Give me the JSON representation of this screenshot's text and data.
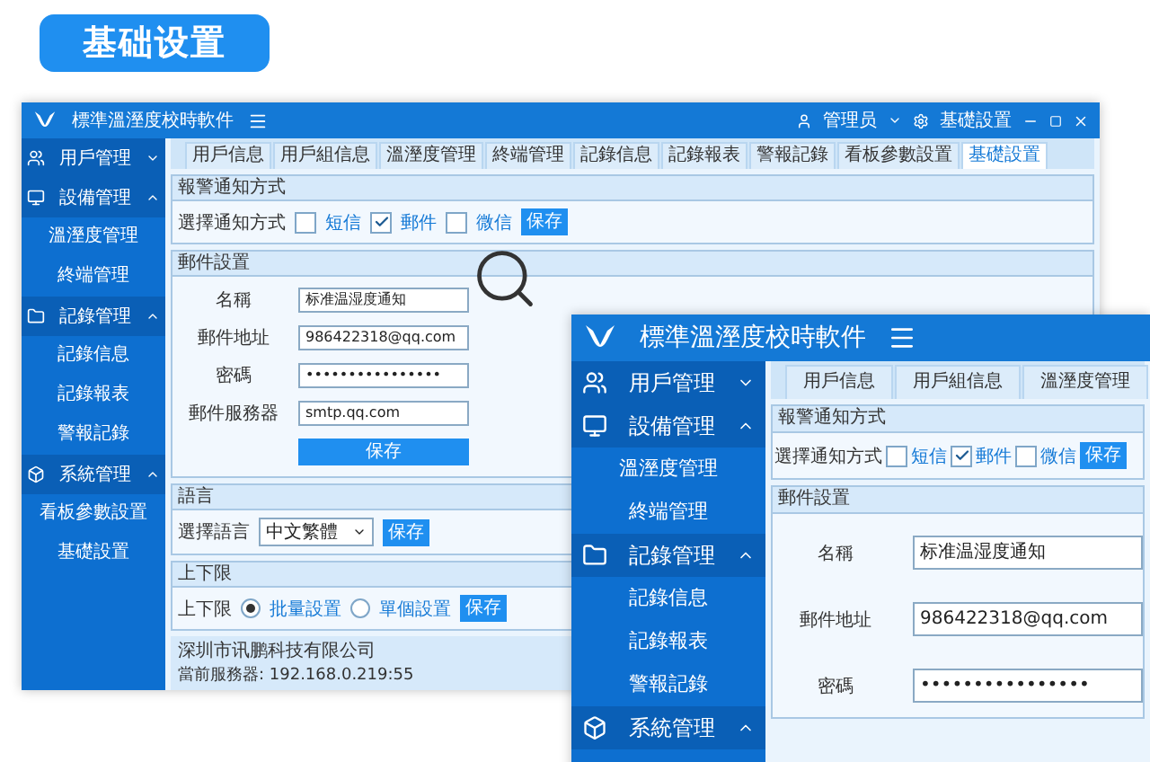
{
  "header": {
    "title": "基础设置"
  },
  "back_window": {
    "title": "標準溫溼度校時軟件",
    "user": "管理员",
    "settings_link": "基礎設置",
    "sidebar": [
      {
        "label": "用戶管理",
        "expanded": false
      },
      {
        "label": "設備管理",
        "expanded": true,
        "children": [
          {
            "label": "溫溼度管理"
          },
          {
            "label": "終端管理"
          }
        ]
      },
      {
        "label": "記錄管理",
        "expanded": true,
        "children": [
          {
            "label": "記錄信息"
          },
          {
            "label": "記錄報表"
          },
          {
            "label": "警報記錄"
          }
        ]
      },
      {
        "label": "系統管理",
        "expanded": true,
        "children": [
          {
            "label": "看板參數設置"
          },
          {
            "label": "基礎設置"
          }
        ]
      }
    ],
    "tabs": [
      {
        "label": "用戶信息",
        "selected": false
      },
      {
        "label": "用戶組信息",
        "selected": false
      },
      {
        "label": "溫溼度管理",
        "selected": false
      },
      {
        "label": "終端管理",
        "selected": false
      },
      {
        "label": "記錄信息",
        "selected": false
      },
      {
        "label": "記錄報表",
        "selected": false
      },
      {
        "label": "警報記錄",
        "selected": false
      },
      {
        "label": "看板參數設置",
        "selected": false
      },
      {
        "label": "基礎設置",
        "selected": true
      }
    ],
    "sections": [
      {
        "kind": "checkboxes",
        "title": "報警通知方式",
        "label": "選擇通知方式",
        "options": [
          {
            "label": "短信",
            "checked": false
          },
          {
            "label": "郵件",
            "checked": true
          },
          {
            "label": "微信",
            "checked": false
          }
        ],
        "button": "保存"
      },
      {
        "kind": "form",
        "title": "郵件設置",
        "fields": [
          {
            "label": "名稱",
            "value": "标准温湿度通知"
          },
          {
            "label": "郵件地址",
            "value": "986422318@qq.com"
          },
          {
            "label": "密碼",
            "value": "••••••••••••••••"
          },
          {
            "label": "郵件服務器",
            "value": "smtp.qq.com"
          }
        ],
        "button": "保存"
      },
      {
        "kind": "select",
        "title": "語言",
        "label": "選擇語言",
        "value": "中文繁體",
        "button": "保存"
      },
      {
        "kind": "radios",
        "title": "上下限",
        "label": "上下限",
        "options": [
          {
            "label": "批量設置",
            "selected": true
          },
          {
            "label": "單個設置",
            "selected": false
          }
        ],
        "button": "保存"
      }
    ],
    "status_bar": {
      "company": "深圳市讯鹏科技有限公司",
      "server": "當前服務器: 192.168.0.219:55"
    }
  },
  "front_window": {
    "title": "標準溫溼度校時軟件",
    "sidebar": [
      {
        "label": "用戶管理",
        "expanded": false
      },
      {
        "label": "設備管理",
        "expanded": true,
        "children": [
          {
            "label": "溫溼度管理"
          },
          {
            "label": "終端管理"
          }
        ]
      },
      {
        "label": "記錄管理",
        "expanded": true,
        "children": [
          {
            "label": "記錄信息"
          },
          {
            "label": "記錄報表"
          },
          {
            "label": "警報記錄"
          }
        ]
      },
      {
        "label": "系統管理",
        "expanded": true
      }
    ],
    "tabs": [
      {
        "label": "用戶信息",
        "selected": false
      },
      {
        "label": "用戶組信息",
        "selected": false
      },
      {
        "label": "溫溼度管理",
        "selected": false
      }
    ],
    "sections": [
      {
        "kind": "checkboxes",
        "title": "報警通知方式",
        "label": "選擇通知方式",
        "options": [
          {
            "label": "短信",
            "checked": false
          },
          {
            "label": "郵件",
            "checked": true
          },
          {
            "label": "微信",
            "checked": false
          }
        ],
        "button": "保存"
      },
      {
        "kind": "form",
        "title": "郵件設置",
        "fields": [
          {
            "label": "名稱",
            "value": "标准温湿度通知"
          },
          {
            "label": "郵件地址",
            "value": "986422318@qq.com"
          },
          {
            "label": "密碼",
            "value": "••••••••••••••••"
          }
        ]
      }
    ]
  }
}
